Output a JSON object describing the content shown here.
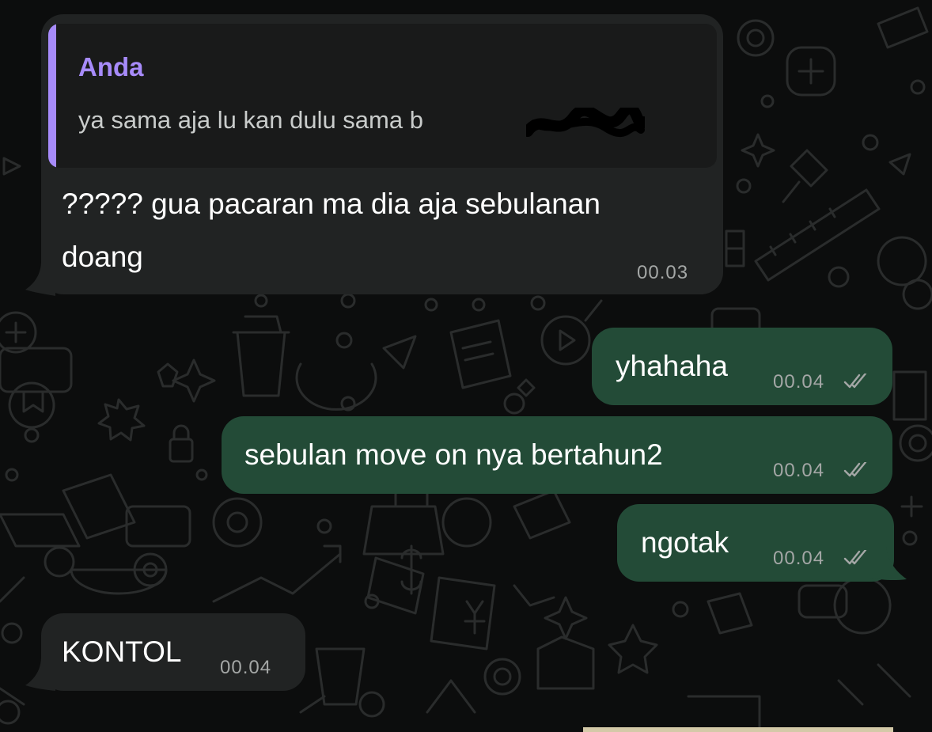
{
  "theme": {
    "background": "#0c0d0d",
    "incoming_bubble": "#212323",
    "outgoing_bubble": "#234b37",
    "quote_accent": "#a78bfa",
    "timestamp_color": "#a4a7a6"
  },
  "messages": [
    {
      "direction": "incoming",
      "reply_to": {
        "author": "Anda",
        "text": "ya sama aja lu kan dulu sama b"
      },
      "lines": [
        "????? gua pacaran ma dia aja sebulanan",
        "doang"
      ],
      "time": "00.03"
    },
    {
      "direction": "outgoing",
      "text": "yhahaha",
      "time": "00.04",
      "status": "read-double-check-icon"
    },
    {
      "direction": "outgoing",
      "text": "sebulan move on nya bertahun2",
      "time": "00.04",
      "status": "read-double-check-icon"
    },
    {
      "direction": "outgoing",
      "text": "ngotak",
      "time": "00.04",
      "status": "read-double-check-icon"
    },
    {
      "direction": "incoming",
      "text": "KONTOL",
      "time": "00.04"
    }
  ]
}
